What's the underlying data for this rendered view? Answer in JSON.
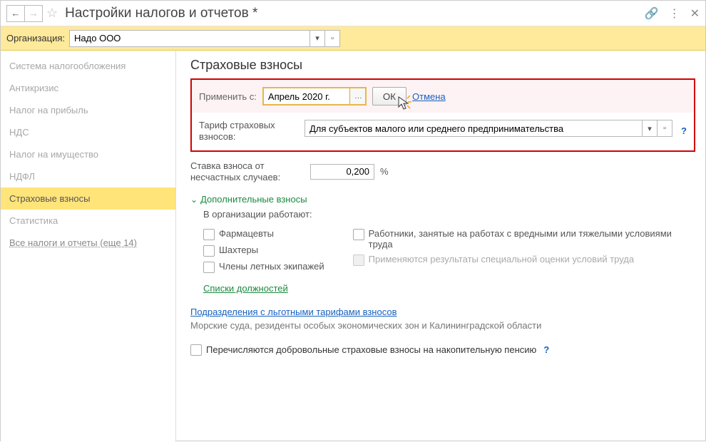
{
  "titlebar": {
    "title": "Настройки налогов и отчетов *"
  },
  "orgbar": {
    "label": "Организация:",
    "value": "Надо ООО"
  },
  "sidebar": {
    "items": [
      "Система налогообложения",
      "Антикризис",
      "Налог на прибыль",
      "НДС",
      "Налог на имущество",
      "НДФЛ",
      "Страховые взносы",
      "Статистика"
    ],
    "active_index": 6,
    "more_link": "Все налоги и отчеты (еще 14)"
  },
  "main": {
    "heading": "Страховые взносы",
    "apply": {
      "label": "Применить с:",
      "value": "Апрель 2020 г.",
      "ok": "ОК",
      "cancel": "Отмена"
    },
    "tariff": {
      "label": "Тариф страховых взносов:",
      "value": "Для субъектов малого или среднего предпринимательства"
    },
    "rate": {
      "label": "Ставка взноса от несчастных случаев:",
      "value": "0,200",
      "unit": "%"
    },
    "extra": {
      "toggle": "Дополнительные взносы",
      "subtitle": "В организации работают:",
      "left": [
        "Фармацевты",
        "Шахтеры",
        "Члены летных экипажей"
      ],
      "right_top": "Работники, занятые на работах с вредными или тяжелыми условиями труда",
      "right_disabled": "Применяются результаты специальной оценки условий труда",
      "link_positions": "Списки должностей"
    },
    "divisions_link": "Подразделения с льготными тарифами взносов",
    "divisions_note": "Морские суда, резиденты особых экономических зон и Калининградской области",
    "pension": "Перечисляются добровольные страховые взносы на накопительную пенсию",
    "help": "?"
  }
}
